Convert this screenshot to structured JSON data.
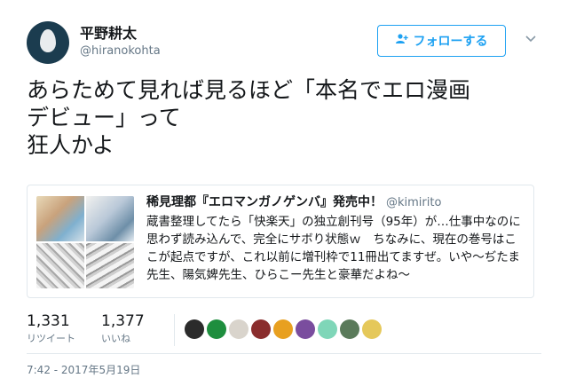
{
  "author": {
    "name": "平野耕太",
    "handle": "@hiranokohta"
  },
  "follow_button": {
    "label": "フォローする"
  },
  "tweet": {
    "text": "あらためて見れば見るほど「本名でエロ漫画\nデビュー」って\n狂人かよ"
  },
  "quoted_tweet": {
    "name": "稀見理都『エロマンガノゲンバ』発売中！",
    "handle": "@kimirito",
    "text": "蔵書整理してたら「快楽天」の独立創刊号（95年）が…仕事中なのに思わず読み込んで、完全にサボり状態ｗ　ちなみに、現在の巻号はここが起点ですが、これ以前に増刊枠で11冊出てますぜ。いや〜ぢたま先生、陽気婢先生、ひらこー先生と豪華だよね〜"
  },
  "stats": {
    "retweets": {
      "count": "1,331",
      "label": "リツイート"
    },
    "likes": {
      "count": "1,377",
      "label": "いいね"
    }
  },
  "likers": [
    {
      "color": "#2b2b2b"
    },
    {
      "color": "#1e8e3e"
    },
    {
      "color": "#d9d4cc"
    },
    {
      "color": "#8a2d2d"
    },
    {
      "color": "#e8a020"
    },
    {
      "color": "#7a4d9e"
    },
    {
      "color": "#7fd6b8"
    },
    {
      "color": "#5a7a5a"
    },
    {
      "color": "#e5c85a"
    }
  ],
  "timestamp": "7:42 - 2017年5月19日",
  "icons": {
    "follow": "add-user-icon",
    "caret": "chevron-down-icon"
  }
}
